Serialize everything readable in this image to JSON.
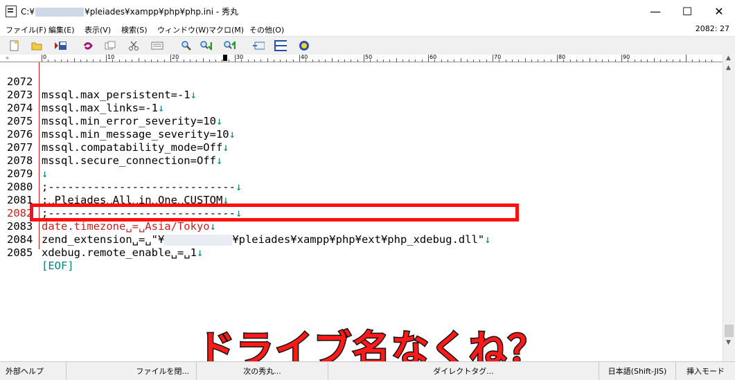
{
  "window": {
    "title_prefix": "C:¥",
    "title_suffix": "¥pleiades¥xampp¥php¥php.ini  - 秀丸",
    "minimize": "—",
    "maximize": "☐",
    "close": "✕"
  },
  "menu": {
    "items": [
      "ファイル(F)",
      "編集(E)",
      "表示(V)",
      "検索(S)",
      "ウィンドウ(W)",
      "マクロ(M)",
      "その他(O)"
    ],
    "position": "2082: 27"
  },
  "ruler": {
    "marker": "»",
    "labels": [
      "0",
      "10",
      "20",
      "30",
      "40",
      "50",
      "60",
      "70",
      "80",
      "90"
    ]
  },
  "editor": {
    "lines": [
      {
        "num": "2072",
        "text": "mssql.max_persistent=-1",
        "eol": "↓"
      },
      {
        "num": "2073",
        "text": "mssql.max_links=-1",
        "eol": "↓"
      },
      {
        "num": "2074",
        "text": "mssql.min_error_severity=10",
        "eol": "↓"
      },
      {
        "num": "2075",
        "text": "mssql.min_message_severity=10",
        "eol": "↓"
      },
      {
        "num": "2076",
        "text": "mssql.compatability_mode=Off",
        "eol": "↓"
      },
      {
        "num": "2077",
        "text": "mssql.secure_connection=Off",
        "eol": "↓"
      },
      {
        "num": "2078",
        "text": "",
        "eol": "↓"
      },
      {
        "num": "2079",
        "text": ";-----------------------------",
        "eol": "↓"
      },
      {
        "num": "2080",
        "text": ";␣Pleiades␣All␣in␣One␣CUSTOM",
        "eol": "↓"
      },
      {
        "num": "2081",
        "text": ";-----------------------------",
        "eol": "↓"
      },
      {
        "num": "2082",
        "text": "date.timezone␣=␣Asia/Tokyo",
        "eol": "↓"
      },
      {
        "num": "2083",
        "text_a": "zend_extension␣=␣\"¥",
        "text_b": "¥pleiades¥xampp¥php¥ext¥php_xdebug.dll\"",
        "eol": "↓"
      },
      {
        "num": "2084",
        "text": "xdebug.remote_enable␣=␣1",
        "eol": "↓"
      },
      {
        "num": "2085",
        "text": "",
        "eof": "[EOF]"
      }
    ]
  },
  "overlay": {
    "caption": "ドライブ名なくね？"
  },
  "status": {
    "cells": [
      "外部ヘルプ",
      "ファイルを閉...",
      "次の秀丸...",
      "ダイレクトタグ...",
      "日本語(Shift-JIS)",
      "挿入モード"
    ]
  }
}
